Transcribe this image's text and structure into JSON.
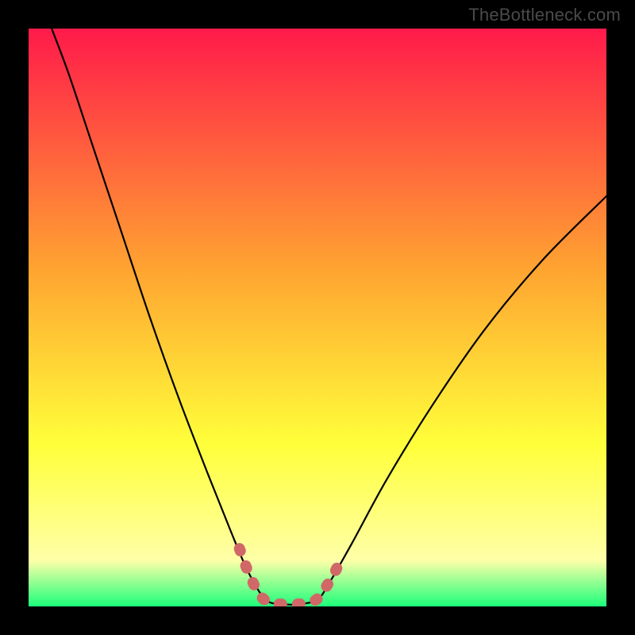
{
  "watermark": "TheBottleneck.com",
  "chart_data": {
    "type": "line",
    "title": "",
    "xlabel": "",
    "ylabel": "",
    "xlim": [
      0,
      100
    ],
    "ylim": [
      0,
      100
    ],
    "background_gradient": {
      "top": "#ff1a4a",
      "mid_orange": "#ffa531",
      "mid_yellow": "#ffff3a",
      "pale_yellow": "#ffffa8",
      "bottom": "#1cff7a"
    },
    "series": [
      {
        "name": "bottleneck-curve",
        "color": "#000000",
        "points": [
          {
            "x": 4.0,
            "y": 100.0
          },
          {
            "x": 7.0,
            "y": 92.0
          },
          {
            "x": 11.0,
            "y": 80.0
          },
          {
            "x": 16.0,
            "y": 65.0
          },
          {
            "x": 21.0,
            "y": 50.0
          },
          {
            "x": 26.0,
            "y": 36.0
          },
          {
            "x": 31.0,
            "y": 23.0
          },
          {
            "x": 35.0,
            "y": 13.0
          },
          {
            "x": 38.0,
            "y": 6.0
          },
          {
            "x": 41.0,
            "y": 1.2
          },
          {
            "x": 44.0,
            "y": 0.4
          },
          {
            "x": 47.0,
            "y": 0.4
          },
          {
            "x": 50.0,
            "y": 1.2
          },
          {
            "x": 52.0,
            "y": 4.0
          },
          {
            "x": 56.0,
            "y": 11.0
          },
          {
            "x": 62.0,
            "y": 22.0
          },
          {
            "x": 70.0,
            "y": 35.0
          },
          {
            "x": 79.0,
            "y": 48.0
          },
          {
            "x": 89.0,
            "y": 60.0
          },
          {
            "x": 100.0,
            "y": 71.0
          }
        ]
      },
      {
        "name": "optimal-segment",
        "color": "#d16868",
        "thick": true,
        "points": [
          {
            "x": 36.5,
            "y": 10.0
          },
          {
            "x": 38.0,
            "y": 6.0
          },
          {
            "x": 40.0,
            "y": 2.0
          },
          {
            "x": 42.0,
            "y": 0.6
          },
          {
            "x": 45.0,
            "y": 0.4
          },
          {
            "x": 47.5,
            "y": 0.5
          },
          {
            "x": 49.5,
            "y": 1.0
          },
          {
            "x": 50.5,
            "y": 2.0
          },
          {
            "x": 52.5,
            "y": 5.0
          },
          {
            "x": 54.5,
            "y": 9.0
          }
        ]
      }
    ]
  }
}
